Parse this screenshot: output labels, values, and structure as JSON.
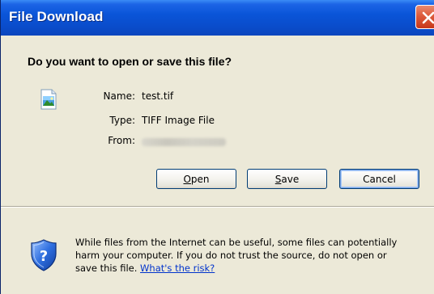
{
  "window": {
    "title": "File Download"
  },
  "dialog": {
    "question": "Do you want to open or save this file?",
    "fields": [
      {
        "label": "Name:",
        "value": "test.tif"
      },
      {
        "label": "Type:",
        "value": "TIFF Image File"
      },
      {
        "label": "From:",
        "value": ""
      }
    ],
    "buttons": {
      "open_mnemonic": "O",
      "open_rest": "pen",
      "save_mnemonic": "S",
      "save_rest": "ave",
      "cancel": "Cancel"
    },
    "warning": {
      "line1": "While files from the Internet can be useful, some files can potentially",
      "line2": "harm your computer. If you do not trust the source, do not open or",
      "line3_prefix": "save this file. ",
      "link": "What's the risk?"
    }
  },
  "icons": {
    "close": "close-icon",
    "file": "tiff-image-file-icon",
    "warning": "security-shield-question-icon"
  },
  "colors": {
    "titlebar": "#0a55d8",
    "body": "#ece9d8",
    "close": "#dd5b3c",
    "link": "#0033cc",
    "button_border": "#003c74"
  }
}
